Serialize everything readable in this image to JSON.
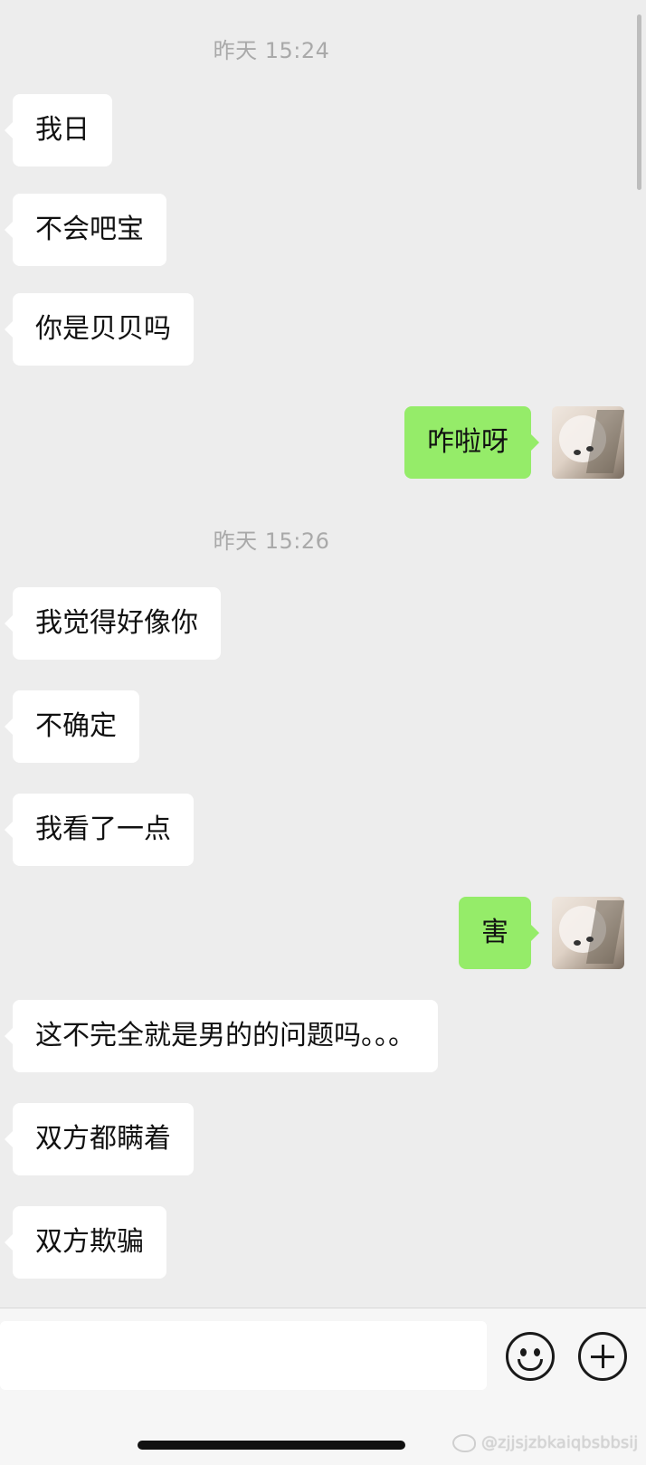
{
  "timestamps": [
    "昨天 15:24",
    "昨天 15:26"
  ],
  "messages": [
    {
      "side": "in",
      "text": "我日"
    },
    {
      "side": "in",
      "text": "不会吧宝"
    },
    {
      "side": "in",
      "text": "你是贝贝吗"
    },
    {
      "side": "out",
      "text": "咋啦呀"
    },
    {
      "side": "in",
      "text": "我觉得好像你"
    },
    {
      "side": "in",
      "text": "不确定"
    },
    {
      "side": "in",
      "text": "我看了一点"
    },
    {
      "side": "out",
      "text": "害"
    },
    {
      "side": "in",
      "text": "这不完全就是男的的问题吗。。。"
    },
    {
      "side": "in",
      "text": "双方都瞒着"
    },
    {
      "side": "in",
      "text": "双方欺骗"
    }
  ],
  "input_bar": {
    "value": "",
    "emoji_icon": "emoji-icon",
    "plus_icon": "plus-icon"
  },
  "watermark": {
    "text": "@zjjsjzbkaiqbsbbsij"
  },
  "colors": {
    "background": "#ededed",
    "incoming_bubble": "#ffffff",
    "outgoing_bubble": "#95ec69",
    "timestamp": "#a9a9a9"
  }
}
